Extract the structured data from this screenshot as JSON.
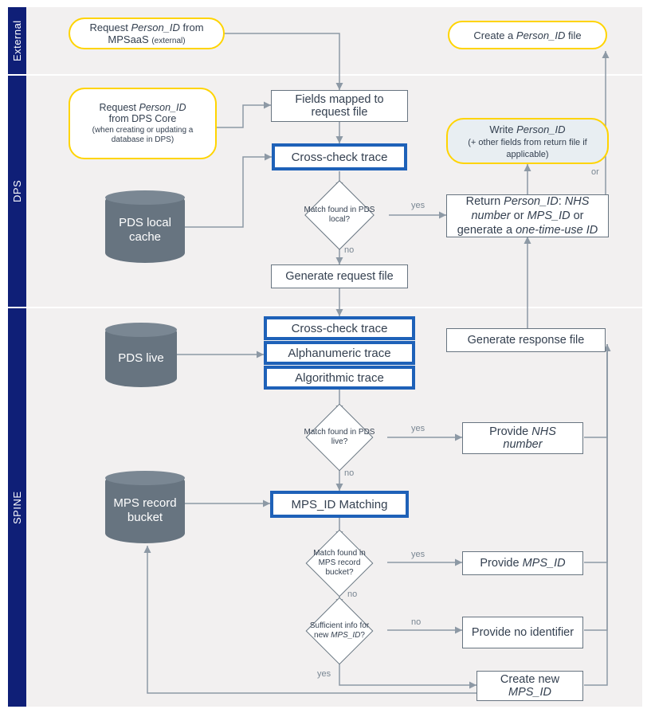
{
  "lanes": {
    "external": "External",
    "dps": "DPS",
    "spine": "SPINE"
  },
  "nodes": {
    "ext_request": [
      "Request ",
      "Person_ID",
      " from MPSaaS ",
      "(external)"
    ],
    "create_file": [
      "Create a ",
      "Person_ID",
      " file"
    ],
    "dps_request": [
      "Request ",
      "Person_ID",
      " from DPS Core",
      "(when creating or updating a database in DPS)"
    ],
    "fields_mapped": "Fields mapped to request file",
    "cross_check": "Cross-check trace",
    "write_pid": [
      "Write ",
      "Person_ID",
      "(+ other fields from return file if applicable)"
    ],
    "match_pds_local": "Match found in PDS local?",
    "return_pid": [
      "Return ",
      "Person_ID",
      ": ",
      "NHS number",
      " or ",
      "MPS_ID",
      " or generate a ",
      "one-time-use ID"
    ],
    "gen_request": "Generate request file",
    "pds_local_cache": "PDS local cache",
    "pds_live": "PDS live",
    "cross_check2": "Cross-check trace",
    "alnum_trace": "Alphanumeric trace",
    "algo_trace": "Algorithmic trace",
    "gen_response": "Generate response file",
    "match_pds_live": "Match found in PDS live?",
    "provide_nhs": [
      "Provide ",
      "NHS number"
    ],
    "mps_bucket": "MPS record bucket",
    "mps_matching": "MPS_ID Matching",
    "match_mps_bucket": "Match found in MPS record bucket?",
    "provide_mps": [
      "Provide ",
      "MPS_ID"
    ],
    "sufficient_info": [
      "Sufficient info for new ",
      "MPS_ID",
      "?"
    ],
    "provide_none": "Provide no identifier",
    "create_new": [
      "Create new ",
      "MPS_ID"
    ]
  },
  "labels": {
    "yes": "yes",
    "no": "no",
    "or": "or"
  }
}
